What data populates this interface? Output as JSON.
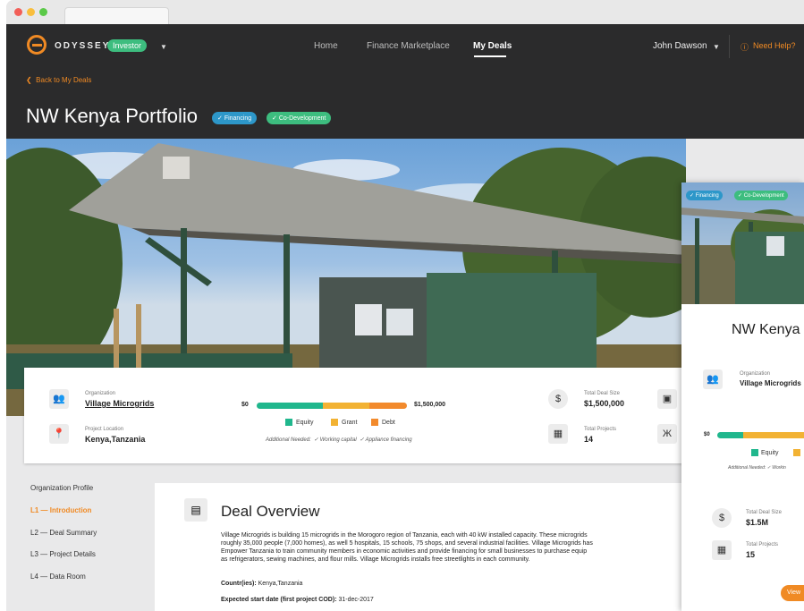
{
  "brand": {
    "name": "ODYSSEY",
    "role_badge": "Investor"
  },
  "nav": {
    "home": "Home",
    "marketplace": "Finance Marketplace",
    "my_deals": "My Deals",
    "user": "John Dawson",
    "help": "Need Help?"
  },
  "header": {
    "back": "Back to My Deals",
    "title": "NW Kenya Portfolio",
    "tags": [
      "Financing",
      "Co-Development"
    ]
  },
  "info": {
    "org_label": "Organization",
    "org_value": "Village Microgrids",
    "loc_label": "Project Location",
    "loc_value": "Kenya,Tanzania",
    "bar_min": "$0",
    "bar_max": "$1,500,000",
    "legend": [
      "Equity",
      "Grant",
      "Debt"
    ],
    "additional": "Additional Needed:",
    "needs": [
      "Working capital",
      "Appliance financing"
    ],
    "deal_size_label": "Total Deal Size",
    "deal_size_value": "$1,500,000",
    "projects_label": "Total Projects",
    "projects_value": "14",
    "funding_split": {
      "equity": 0.44,
      "grant": 0.31,
      "debt": 0.25
    }
  },
  "sidebar": {
    "items": [
      "Organization Profile",
      "L1 — Introduction",
      "L2 — Deal Summary",
      "L3 — Project Details",
      "L4 — Data Room"
    ]
  },
  "overview": {
    "title": "Deal Overview",
    "lines": [
      "Village Microgrids is building 15 microgrids in the Morogoro region of Tanzania, each with 40 kW installed capacity. These microgrids",
      "roughly 35,000 people (7,000 homes), as well 5 hospitals, 15 schools, 75 shops, and several industrial facilities. Village Microgrids has",
      "Empower Tanzania to train community members in economic activities and provide financing for small businesses to purchase equip",
      "as refrigerators, sewing machines, and flour mills. Village Microgrids installs free streetlights in each community."
    ],
    "countries_label": "Countr(ies):",
    "countries_value": "Kenya,Tanzania",
    "start_label": "Expected start date (first project COD):",
    "start_value": "31-dec-2017"
  },
  "panel": {
    "tags": [
      "Financing",
      "Co-Development"
    ],
    "title": "NW Kenya",
    "org_label": "Organization",
    "org_value": "Village Microgrids",
    "bar_min": "$0",
    "legend": "Equity",
    "additional": "Additional Needed:",
    "need": "Workin",
    "deal_size_label": "Total Deal Size",
    "deal_size_value": "$1.5M",
    "projects_label": "Total Projects",
    "projects_value": "15",
    "button": "View"
  },
  "colors": {
    "accent": "#f08a24",
    "green": "#3dbd7f",
    "blue": "#2d97c9",
    "equity": "#20b78d",
    "grant": "#f2b233",
    "debt": "#f28a2c"
  },
  "icons": [
    "back-chevron-icon",
    "group-icon",
    "pin-icon",
    "dollar-icon",
    "solar-panel-icon",
    "chart-icon",
    "tower-icon",
    "document-icon",
    "help-circle-icon"
  ]
}
